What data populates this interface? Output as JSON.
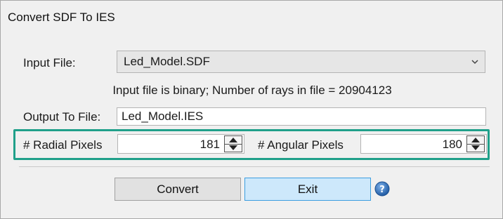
{
  "window": {
    "title": "Convert SDF To IES"
  },
  "input_file": {
    "label": "Input File:",
    "selected": "Led_Model.SDF"
  },
  "info_text": "Input file is binary; Number of rays in file = 20904123",
  "output_file": {
    "label": "Output To File:",
    "value": "Led_Model.IES"
  },
  "radial": {
    "label": "# Radial Pixels",
    "value": "181"
  },
  "angular": {
    "label": "# Angular Pixels",
    "value": "180"
  },
  "buttons": {
    "convert": "Convert",
    "exit": "Exit"
  },
  "icons": {
    "help": "help-icon",
    "dropdown": "chevron-down-icon",
    "spin_up": "arrow-up-icon",
    "spin_down": "arrow-down-icon"
  },
  "colors": {
    "highlight": "#20a08a",
    "exit_bg": "#cde8fb",
    "exit_border": "#3c9ee0",
    "help_blue": "#2f6fb7"
  }
}
